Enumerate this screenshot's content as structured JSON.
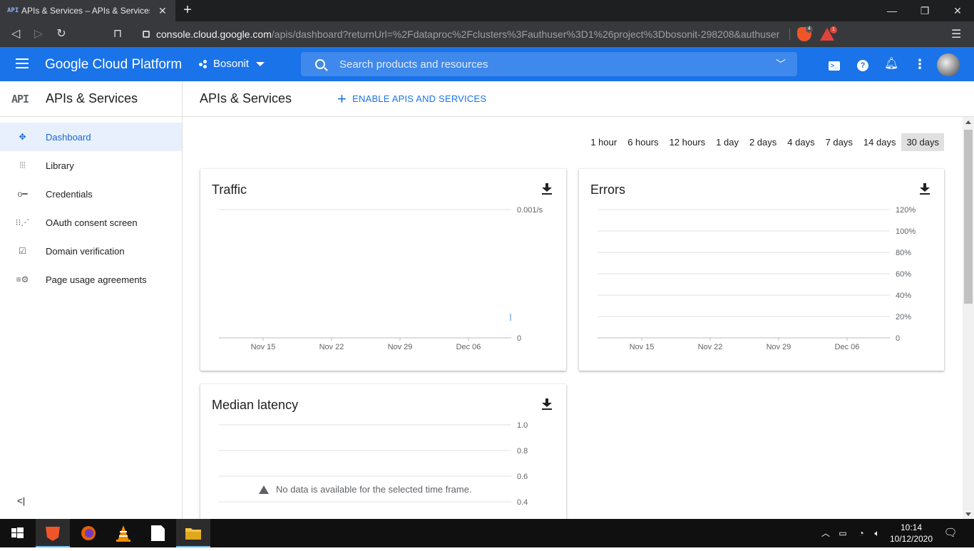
{
  "browser": {
    "tab_title": "APIs & Services – APIs & Services –",
    "tab_favicon": "API",
    "url_host": "console.cloud.google.com",
    "url_path": "/apis/dashboard?returnUrl=%2Fdataproc%2Fclusters%3Fauthuser%3D1%26project%3Dbosonit-298208&authuser...",
    "brave_badge": "4",
    "rewards_badge": "1"
  },
  "header": {
    "logo": "Google Cloud Platform",
    "project": "Bosonit",
    "search_placeholder": "Search products and resources"
  },
  "sidebar": {
    "logo": "API",
    "title": "APIs & Services",
    "items": [
      {
        "label": "Dashboard",
        "icon": "dashboard-icon"
      },
      {
        "label": "Library",
        "icon": "library-icon"
      },
      {
        "label": "Credentials",
        "icon": "key-icon"
      },
      {
        "label": "OAuth consent screen",
        "icon": "oauth-icon"
      },
      {
        "label": "Domain verification",
        "icon": "checkbox-icon"
      },
      {
        "label": "Page usage agreements",
        "icon": "settings-list-icon"
      }
    ]
  },
  "main": {
    "title": "APIs & Services",
    "enable_label": "ENABLE APIS AND SERVICES",
    "time_ranges": [
      "1 hour",
      "6 hours",
      "12 hours",
      "1 day",
      "2 days",
      "4 days",
      "7 days",
      "14 days",
      "30 days"
    ],
    "selected_range": "30 days",
    "no_data": "No data is available for the selected time frame."
  },
  "chart_data": [
    {
      "type": "line",
      "title": "Traffic",
      "x_ticks": [
        "Nov 15",
        "Nov 22",
        "Nov 29",
        "Dec 06"
      ],
      "y_ticks": [
        "0.001/s",
        "0"
      ],
      "ylim": [
        0,
        0.001
      ],
      "series": [
        {
          "x": [
            "Dec 12"
          ],
          "values": [
            0.00016
          ]
        }
      ]
    },
    {
      "type": "line",
      "title": "Errors",
      "x_ticks": [
        "Nov 15",
        "Nov 22",
        "Nov 29",
        "Dec 06"
      ],
      "y_ticks": [
        "120%",
        "100%",
        "80%",
        "60%",
        "40%",
        "20%",
        "0"
      ],
      "ylim": [
        0,
        120
      ],
      "series": []
    },
    {
      "type": "line",
      "title": "Median latency",
      "y_ticks": [
        "1.0",
        "0.8",
        "0.6",
        "0.4"
      ],
      "series": []
    }
  ],
  "taskbar": {
    "time": "10:14",
    "date": "10/12/2020"
  }
}
